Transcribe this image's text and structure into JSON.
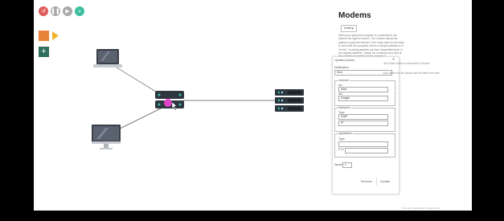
{
  "toolbar": {
    "buttons": [
      {
        "name": "reset-button",
        "icon": "reset-icon",
        "color": "#e05a5a",
        "glyph": "↺"
      },
      {
        "name": "pause-button",
        "icon": "pause-icon",
        "color": "#a9a9a9",
        "glyph": "❚❚"
      },
      {
        "name": "play-button",
        "icon": "play-icon",
        "color": "#a9a9a9",
        "glyph": "▶"
      },
      {
        "name": "fast-forward-button",
        "icon": "fast-forward-icon",
        "color": "#3bbf9f",
        "glyph": "»"
      }
    ]
  },
  "side_tools": [
    {
      "name": "folder-button",
      "icon": "folder-icon",
      "color": "#e8833a"
    },
    {
      "name": "run-button",
      "icon": "play-triangle-icon",
      "color": "#f0b42d"
    },
    {
      "name": "add-button",
      "icon": "add-icon",
      "color": "#2e6f5e",
      "glyph": "+"
    }
  ],
  "colors": {
    "accent": "#e05a5a",
    "modem_highlight": "#e045c9",
    "teal": "#3bbf9f"
  },
  "panel": {
    "title": "Modems",
    "tab_label": "Level ip",
    "description": "When your personal computer is connected to the internet the light is modem. The modem allows the packet to pass the internet. Your hosts need to be ready to send and the computer can be a simple address to a \"home\". Incoming packets are then transmitted back to the original machine. Tweak the resolution and look at the packet's properties before entering it",
    "side_note_1": "all of them follow it connected to Router",
    "side_note_2": "Sub-layers for the packet will be listed here with",
    "form": {
      "heading": "Update product",
      "expand_glyph": "+",
      "destination_label": "Destination",
      "destination_value": "Zero",
      "network_legend": "network",
      "src_label": "src",
      "src_value": "Alice",
      "dst_label": "dst",
      "dst_value": "Google",
      "transport_legend": "transport",
      "transport_label": "Type",
      "transport_value": "ICMP",
      "transport_field_value": "IP",
      "application_legend": "application",
      "app_label": "Type",
      "app_value": "PTC",
      "speed_label": "Speed",
      "speed_value": "1",
      "remove_label": "Remove",
      "update_label": "Update"
    }
  },
  "footer": {
    "links": "Tech Labs | Contributors | Support | Help"
  }
}
